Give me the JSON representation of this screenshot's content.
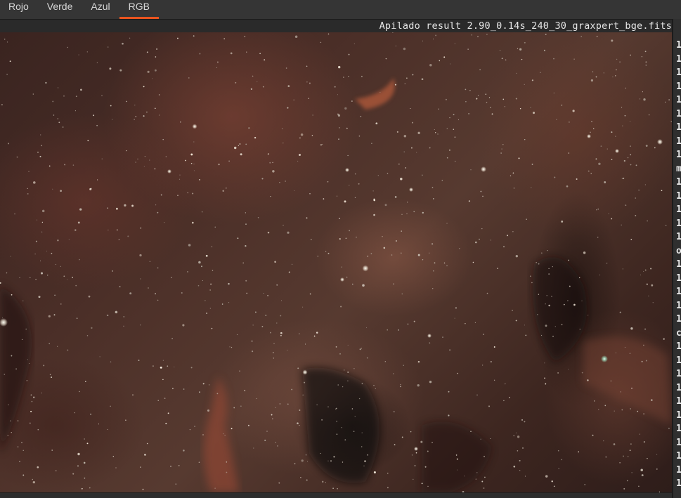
{
  "tabs": [
    {
      "label": "Rojo",
      "active": false
    },
    {
      "label": "Verde",
      "active": false
    },
    {
      "label": "Azul",
      "active": false
    },
    {
      "label": "RGB",
      "active": true
    }
  ],
  "image": {
    "title": "Apilado result 2.90_0.14s_240_30_graxpert_bge.fits"
  },
  "side_panel": {
    "line_prefixes": [
      "1",
      "1",
      "1",
      "1",
      "1",
      "1",
      "1",
      "1",
      "1",
      "m",
      "1",
      "1",
      "1",
      "1",
      "1",
      "o",
      "1",
      "1",
      "1",
      "1",
      "1",
      "c",
      "1",
      "1",
      "1",
      "1",
      "1",
      "1",
      "1",
      "1",
      "1",
      "1",
      "1"
    ]
  },
  "colors": {
    "accent": "#e9541f",
    "background": "#2b2b2b",
    "tabbar": "#353535"
  }
}
